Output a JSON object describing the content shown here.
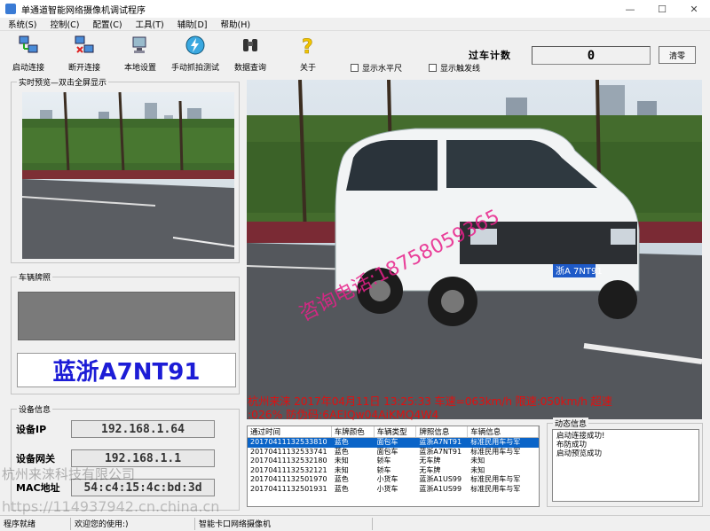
{
  "window": {
    "title": "单通道智能网络摄像机调试程序"
  },
  "menu": [
    "系统(S)",
    "控制(C)",
    "配置(C)",
    "工具(T)",
    "辅助[D]",
    "帮助(H)"
  ],
  "toolbar": {
    "connect": "启动连接",
    "disconnect": "断开连接",
    "local_settings": "本地设置",
    "manual_capture": "手动抓拍测试",
    "data_query": "数据查询",
    "about": "关于",
    "show_horizontal": "显示水平尺",
    "show_trigger_line": "显示触发线"
  },
  "counter": {
    "label": "过车计数",
    "value": "0",
    "clear_label": "清零"
  },
  "preview": {
    "caption": "实时预览—双击全屏显示"
  },
  "plate_group": {
    "caption": "车辆牌照",
    "plate_text": "蓝浙A7NT91"
  },
  "device": {
    "caption": "设备信息",
    "ip_label": "设备IP",
    "ip_value": "192.168.1.64",
    "gw_label": "设备网关",
    "gw_value": "192.168.1.1",
    "mac_label": "MAC地址",
    "mac_value": "54:c4:15:4c:bd:3d"
  },
  "capture_overlay": {
    "line1": "杭州来涞  2017年04月11日 13:25:33 车速=063km/h 限速:050km/h 超速",
    "line2": ":026% 防伪码:6AEIQw04AiKMQ4W4",
    "vehicle_plate": "浙A 7NT91",
    "watermark": "咨询电话:18758059365"
  },
  "records": {
    "columns": [
      "通过时间",
      "车牌颜色",
      "车辆类型",
      "牌照信息",
      "车辆信息"
    ],
    "rows": [
      [
        "20170411132533810",
        "蓝色",
        "面包车",
        "蓝浙A7NT91",
        "标准民用车与军"
      ],
      [
        "20170411132533741",
        "蓝色",
        "面包车",
        "蓝浙A7NT91",
        "标准民用车与军"
      ],
      [
        "20170411132532180",
        "未知",
        "轿车",
        "无车牌",
        "未知"
      ],
      [
        "20170411132532121",
        "未知",
        "轿车",
        "无车牌",
        "未知"
      ],
      [
        "20170411132501970",
        "蓝色",
        "小货车",
        "蓝浙A1US99",
        "标准民用车与军"
      ],
      [
        "20170411132501931",
        "蓝色",
        "小货车",
        "蓝浙A1US99",
        "标准民用车与军"
      ]
    ]
  },
  "dynamic": {
    "caption": "动态信息",
    "lines": [
      "启动连接成功!",
      "布防成功",
      "启动预览成功"
    ]
  },
  "status": {
    "ready": "程序就绪",
    "welcome": "欢迎您的使用:)",
    "product": "智能卡口网络摄像机"
  },
  "page_watermark": {
    "company": "杭州来涞科技有限公司",
    "url": "https://114937942.cn.china.cn"
  },
  "colors": {
    "plate_blue": "#1c1cd6",
    "overlay_red": "#e01010",
    "selection": "#0a64c8"
  }
}
